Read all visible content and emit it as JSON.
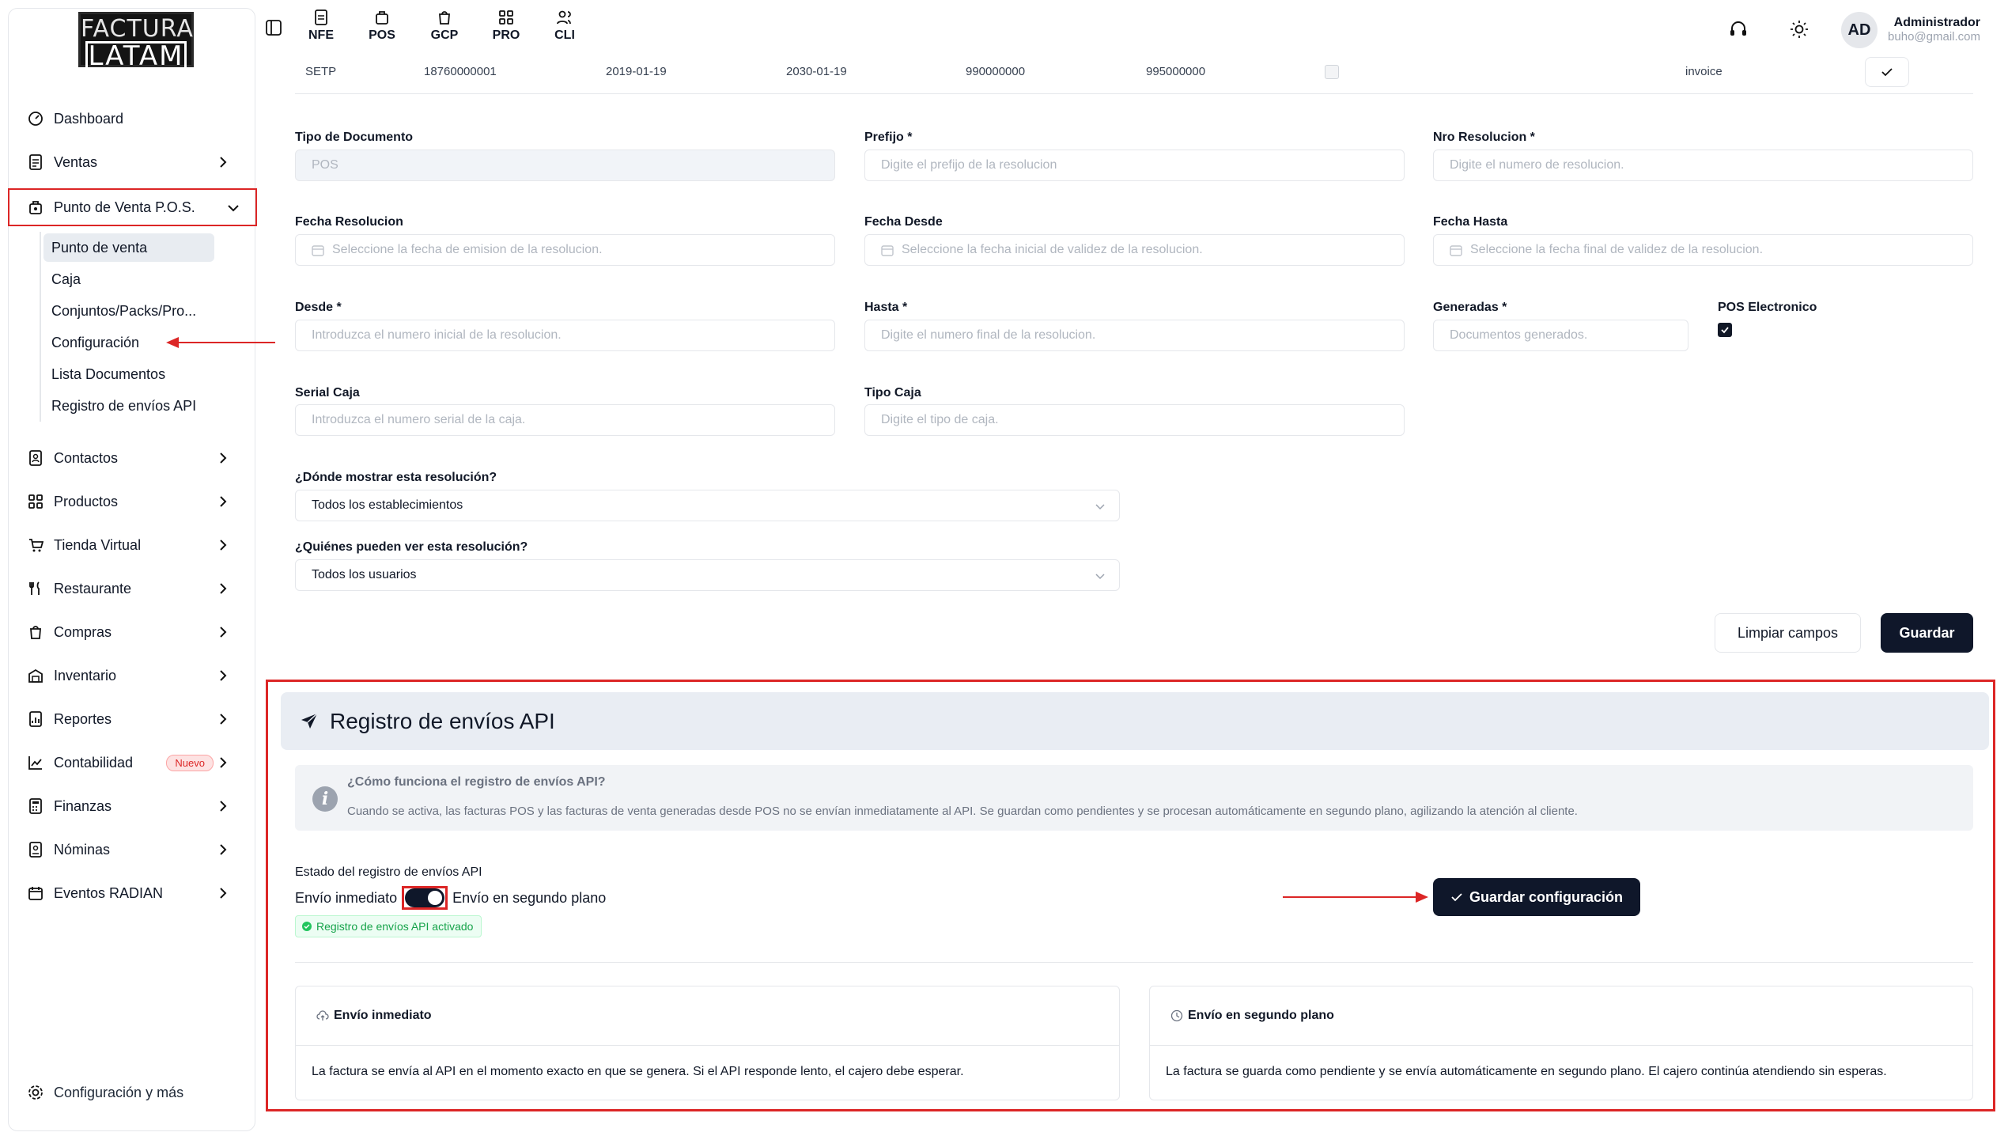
{
  "sidebar": {
    "logo_top": "FACTURA",
    "logo_bottom": "LATAM",
    "items": [
      {
        "label": "Dashboard"
      },
      {
        "label": "Ventas"
      },
      {
        "label": "Punto de Venta P.O.S."
      },
      {
        "label": "Contactos"
      },
      {
        "label": "Productos"
      },
      {
        "label": "Tienda Virtual"
      },
      {
        "label": "Restaurante"
      },
      {
        "label": "Compras"
      },
      {
        "label": "Inventario"
      },
      {
        "label": "Reportes"
      },
      {
        "label": "Contabilidad",
        "badge": "Nuevo"
      },
      {
        "label": "Finanzas"
      },
      {
        "label": "Nóminas"
      },
      {
        "label": "Eventos RADIAN"
      }
    ],
    "pos_subitems": [
      {
        "label": "Punto de venta"
      },
      {
        "label": "Caja"
      },
      {
        "label": "Conjuntos/Packs/Pro..."
      },
      {
        "label": "Configuración"
      },
      {
        "label": "Lista Documentos"
      },
      {
        "label": "Registro de envíos API"
      }
    ],
    "footer": "Configuración y más"
  },
  "topbar": {
    "tabs": [
      {
        "label": "NFE"
      },
      {
        "label": "POS"
      },
      {
        "label": "GCP"
      },
      {
        "label": "PRO"
      },
      {
        "label": "CLI"
      }
    ],
    "avatar": "AD",
    "user_name": "Administrador",
    "user_email": "buho@gmail.com"
  },
  "resolution_row": {
    "prefix": "SETP",
    "number": "18760000001",
    "date_from": "2019-01-19",
    "date_to": "2030-01-19",
    "from": "990000000",
    "to": "995000000",
    "type": "invoice"
  },
  "form": {
    "tipo_documento": {
      "label": "Tipo de Documento",
      "value": "POS"
    },
    "prefijo": {
      "label": "Prefijo *",
      "placeholder": "Digite el prefijo de la resolucion"
    },
    "nro_resolucion": {
      "label": "Nro Resolucion *",
      "placeholder": "Digite el numero de resolucion."
    },
    "fecha_resolucion": {
      "label": "Fecha Resolucion",
      "placeholder": "Seleccione la fecha de emision de la resolucion."
    },
    "fecha_desde": {
      "label": "Fecha Desde",
      "placeholder": "Seleccione la fecha inicial de validez de la resolucion."
    },
    "fecha_hasta": {
      "label": "Fecha Hasta",
      "placeholder": "Seleccione la fecha final de validez de la resolucion."
    },
    "desde": {
      "label": "Desde *",
      "placeholder": "Introduzca el numero inicial de la resolucion."
    },
    "hasta": {
      "label": "Hasta *",
      "placeholder": "Digite el numero final de la resolucion."
    },
    "generadas": {
      "label": "Generadas *",
      "placeholder": "Documentos generados."
    },
    "pos_electronico": {
      "label": "POS Electronico",
      "checked": true
    },
    "serial_caja": {
      "label": "Serial Caja",
      "placeholder": "Introduzca el numero serial de la caja."
    },
    "tipo_caja": {
      "label": "Tipo Caja",
      "placeholder": "Digite el tipo de caja."
    },
    "donde": {
      "label": "¿Dónde mostrar esta resolución?",
      "value": "Todos los establecimientos"
    },
    "quienes": {
      "label": "¿Quiénes pueden ver esta resolución?",
      "value": "Todos los usuarios"
    },
    "clear_label": "Limpiar campos",
    "save_label": "Guardar"
  },
  "api": {
    "title": "Registro de envíos API",
    "info_title": "¿Cómo funciona el registro de envíos API?",
    "info_desc": "Cuando se activa, las facturas POS y las facturas de venta generadas desde POS no se envían inmediatamente al API. Se guardan como pendientes y se procesan automáticamente en segundo plano, agilizando la atención al cliente.",
    "state_label": "Estado del registro de envíos API",
    "toggle_left": "Envío inmediato",
    "toggle_right": "Envío en segundo plano",
    "toggle_on": true,
    "status": "Registro de envíos API activado",
    "save_config": "Guardar configuración",
    "card_immediate": {
      "title": "Envío inmediato",
      "desc": "La factura se envía al API en el momento exacto en que se genera. Si el API responde lento, el cajero debe esperar."
    },
    "card_background": {
      "title": "Envío en segundo plano",
      "desc": "La factura se guarda como pendiente y se envía automáticamente en segundo plano. El cajero continúa atendiendo sin esperas."
    }
  },
  "colors": {
    "highlight": "#dc2626",
    "primary": "#0f172a",
    "success": "#16a34a"
  }
}
